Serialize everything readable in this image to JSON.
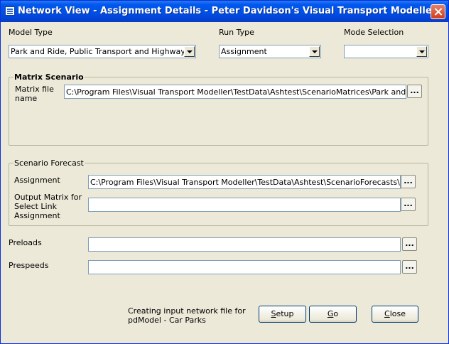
{
  "window": {
    "title": "Network View - Assignment Details - Peter Davidson's Visual Transport Modeller"
  },
  "model_type": {
    "label": "Model Type",
    "value": "Park and Ride, Public Transport and Highway"
  },
  "run_type": {
    "label": "Run Type",
    "value": "Assignment"
  },
  "mode_selection": {
    "label": "Mode Selection",
    "value": ""
  },
  "matrix_scenario": {
    "title": "Matrix Scenario",
    "file_label": "Matrix file name",
    "file_value": "C:\\Program Files\\Visual Transport Modeller\\TestData\\Ashtest\\ScenarioMatrices\\Park and Ride.csv",
    "browse_label": "..."
  },
  "scenario_forecast": {
    "title": "Scenario Forecast",
    "assignment_label": "Assignment",
    "assignment_value": "C:\\Program Files\\Visual Transport Modeller\\TestData\\Ashtest\\ScenarioForecasts\\Scenario",
    "output_label_1": "Output Matrix for",
    "output_label_2": "Select Link",
    "output_label_3": "Assignment",
    "output_value": "",
    "browse_label": "..."
  },
  "preloads": {
    "label": "Preloads",
    "value": "",
    "browse_label": "..."
  },
  "prespeeds": {
    "label": "Prespeeds",
    "value": "",
    "browse_label": "..."
  },
  "status": {
    "line1": "Creating input network file for",
    "line2": "pdModel - Car Parks"
  },
  "buttons": {
    "setup_first": "S",
    "setup_rest": "etup",
    "go_first": "G",
    "go_rest": "o",
    "close_first": "C",
    "close_rest": "lose"
  }
}
